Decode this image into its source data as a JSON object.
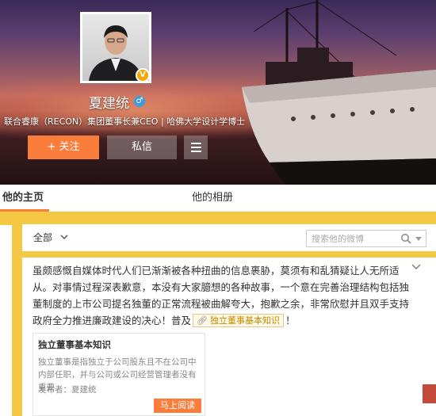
{
  "profile": {
    "name": "夏建统",
    "bio": "联合睿康（RECON）集团董事长兼CEO | 哈佛大学设计学博士",
    "verified_badge": "V",
    "gender_symbol": "♂"
  },
  "actions": {
    "follow_label": "+ 关注",
    "message_label": "私信",
    "more_icon": "menu-icon"
  },
  "tabs": [
    {
      "label": "他的主页",
      "active": true
    },
    {
      "label": "他的相册",
      "active": false
    }
  ],
  "filter": {
    "selected": "全部",
    "search_placeholder": "搜索他的微博"
  },
  "post": {
    "text_before_tag": "虽颇感慨自媒体时代人们已渐渐被各种扭曲的信息裹胁，莫须有和乱猜疑让人无所适从。对事情过程深表歉意，本没有大家臆想的各种故事，一个意在完善治理结构包括独董制度的上市公司提名独董的正常流程被曲解夸大，抱歉之余，非常欣慰并且双手支持政府全力推进廉政建设的决心！普及",
    "tag_label": "独立董事基本知识",
    "text_after_tag": "！",
    "article": {
      "title": "独立董事基本知识",
      "summary": "独立董事是指独立于公司股东且不在公司中内部任职，并与公司或公司经营管理者没有重要",
      "author": "发布者：夏建统",
      "read_button": "马上阅读"
    }
  },
  "colors": {
    "accent": "#fa7d3c",
    "background": "#f4c842",
    "verified": "#f7a500",
    "gender": "#3a9be0"
  }
}
